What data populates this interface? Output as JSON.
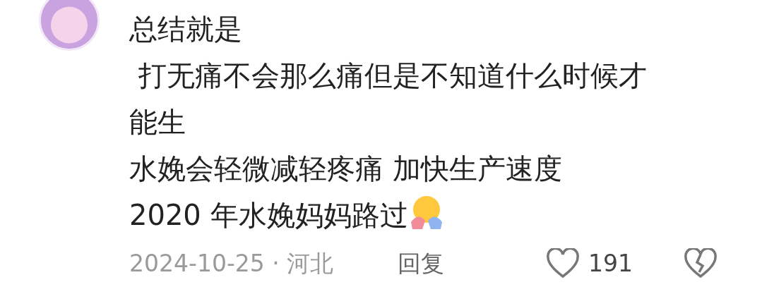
{
  "comment": {
    "lines": [
      "总结就是",
      " 打无痛不会那么痛但是不知道什么时候才能生",
      "水娩会轻微减轻疼痛 加快生产速度",
      "2020 年水娩妈妈路过"
    ],
    "meta": "2024-10-25 · 河北",
    "reply": "回复",
    "likes": "191",
    "liked": false
  }
}
